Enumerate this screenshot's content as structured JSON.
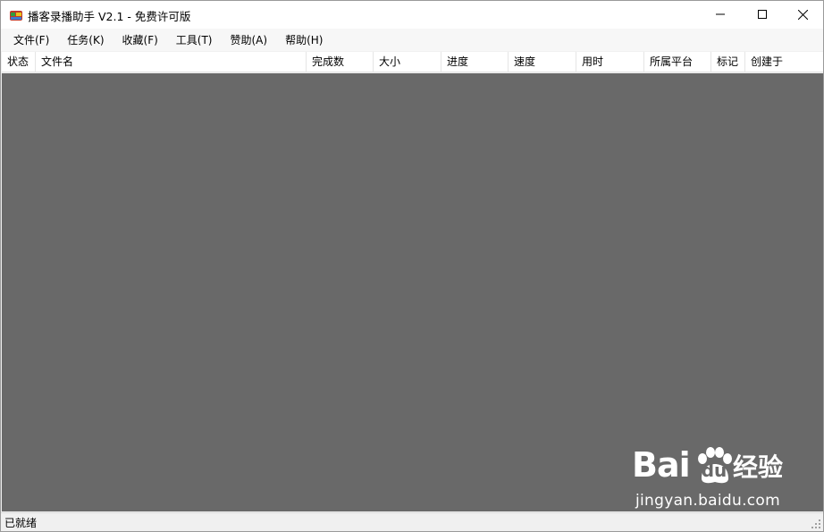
{
  "window": {
    "title": "播客录播助手 V2.1 - 免费许可版",
    "controls": {
      "minimize": "minimize-icon",
      "maximize": "maximize-icon",
      "close": "close-icon"
    }
  },
  "menu": {
    "items": [
      "文件(F)",
      "任务(K)",
      "收藏(F)",
      "工具(T)",
      "赞助(A)",
      "帮助(H)"
    ]
  },
  "list": {
    "columns": [
      "状态",
      "文件名",
      "完成数",
      "大小",
      "进度",
      "速度",
      "用时",
      "所属平台",
      "标记",
      "创建于"
    ],
    "rows": []
  },
  "status": {
    "text": "已就绪"
  },
  "watermark": {
    "brand": "Bai",
    "brand_du": "du",
    "product": "经验",
    "url": "jingyan.baidu.com"
  },
  "colors": {
    "content_bg": "#696969",
    "titlebar_bg": "#ffffff",
    "statusbar_bg": "#f0f0f0"
  }
}
